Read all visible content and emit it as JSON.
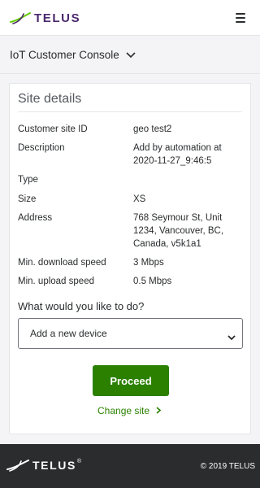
{
  "header": {
    "brand": "TELUS",
    "menu_icon": "hamburger-menu-icon",
    "brand_color": "#4b286d",
    "accent_green": "#66cc00"
  },
  "console": {
    "label": "IoT Customer Console",
    "chevron_icon": "chevron-down-icon"
  },
  "site_details": {
    "title": "Site details",
    "rows": [
      {
        "label": "Customer site ID",
        "value": "geo test2"
      },
      {
        "label": "Description",
        "value": "Add by automation at 2020-11-27_9:46:5"
      },
      {
        "label": "Type",
        "value": ""
      },
      {
        "label": "Size",
        "value": "XS"
      },
      {
        "label": "Address",
        "value": "768 Seymour St, Unit 1234, Vancouver, BC, Canada, v5k1a1"
      },
      {
        "label": "Min. download speed",
        "value": "3 Mbps"
      },
      {
        "label": "Min. upload speed",
        "value": "0.5 Mbps"
      }
    ]
  },
  "action": {
    "question": "What would you like to do?",
    "selected": "Add a new device",
    "proceed_label": "Proceed",
    "proceed_color": "#2b8000",
    "change_site_label": "Change site"
  },
  "footer": {
    "brand": "TELUS",
    "registered": "®",
    "copyright": "© 2019 TELUS",
    "background": "#2a2c2e"
  }
}
